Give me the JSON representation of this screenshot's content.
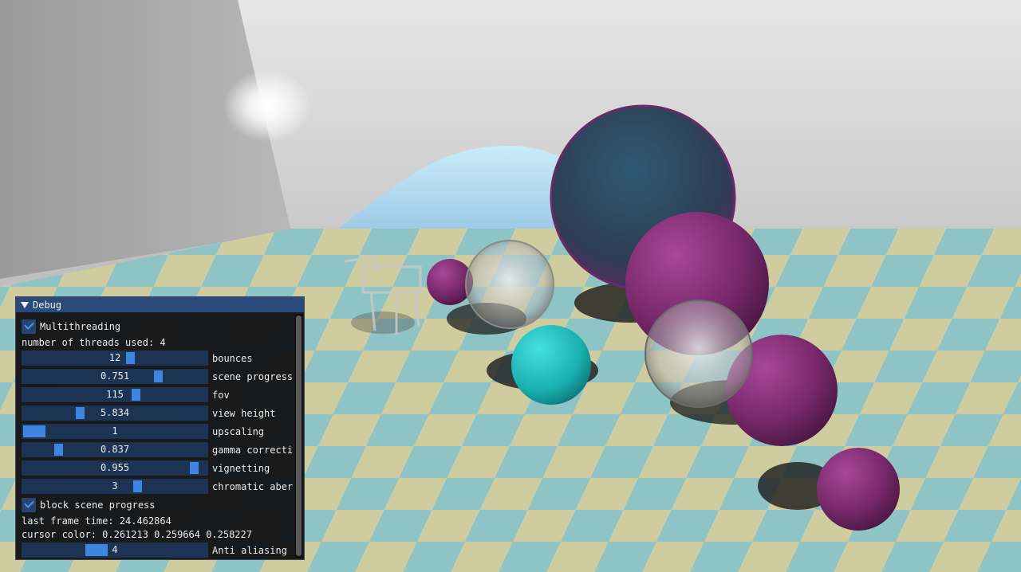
{
  "debug": {
    "title": "Debug",
    "multithreading": {
      "label": "Multithreading",
      "checked": true
    },
    "threads_text": "number of threads used: 4",
    "sliders": [
      {
        "label": "bounces",
        "value": "12",
        "fill": 0.59
      },
      {
        "label": "scene progress",
        "value": "0.751",
        "fill": 0.751
      },
      {
        "label": "fov",
        "value": "115",
        "fill": 0.62
      },
      {
        "label": "view height",
        "value": "5.834",
        "fill": 0.3
      },
      {
        "label": "upscaling",
        "value": "1",
        "fill": 0.0
      },
      {
        "label": "gamma correcti",
        "value": "0.837",
        "fill": 0.18
      },
      {
        "label": "vignetting",
        "value": "0.955",
        "fill": 0.955
      },
      {
        "label": "chromatic aber",
        "value": "3",
        "fill": 0.63
      }
    ],
    "block_scene_progress": {
      "label": "block scene progress",
      "checked": true
    },
    "frame_time_text": "last frame time: 24.462864",
    "cursor_color_text": "cursor color: 0.261213 0.259664 0.258227",
    "anti_aliasing": {
      "label": "Anti aliasing",
      "value": "4",
      "fill": 0.38
    }
  },
  "colors": {
    "accent": "#4296fa",
    "titlebar": "#294a7a",
    "slider_bg": "#1d3354",
    "grab": "#3d85e0",
    "floor_blue": "#8fc4c6",
    "floor_yellow": "#cfcd9f",
    "teal_sphere": "#1fc6c6",
    "purple_sphere": "#8a2f78"
  }
}
